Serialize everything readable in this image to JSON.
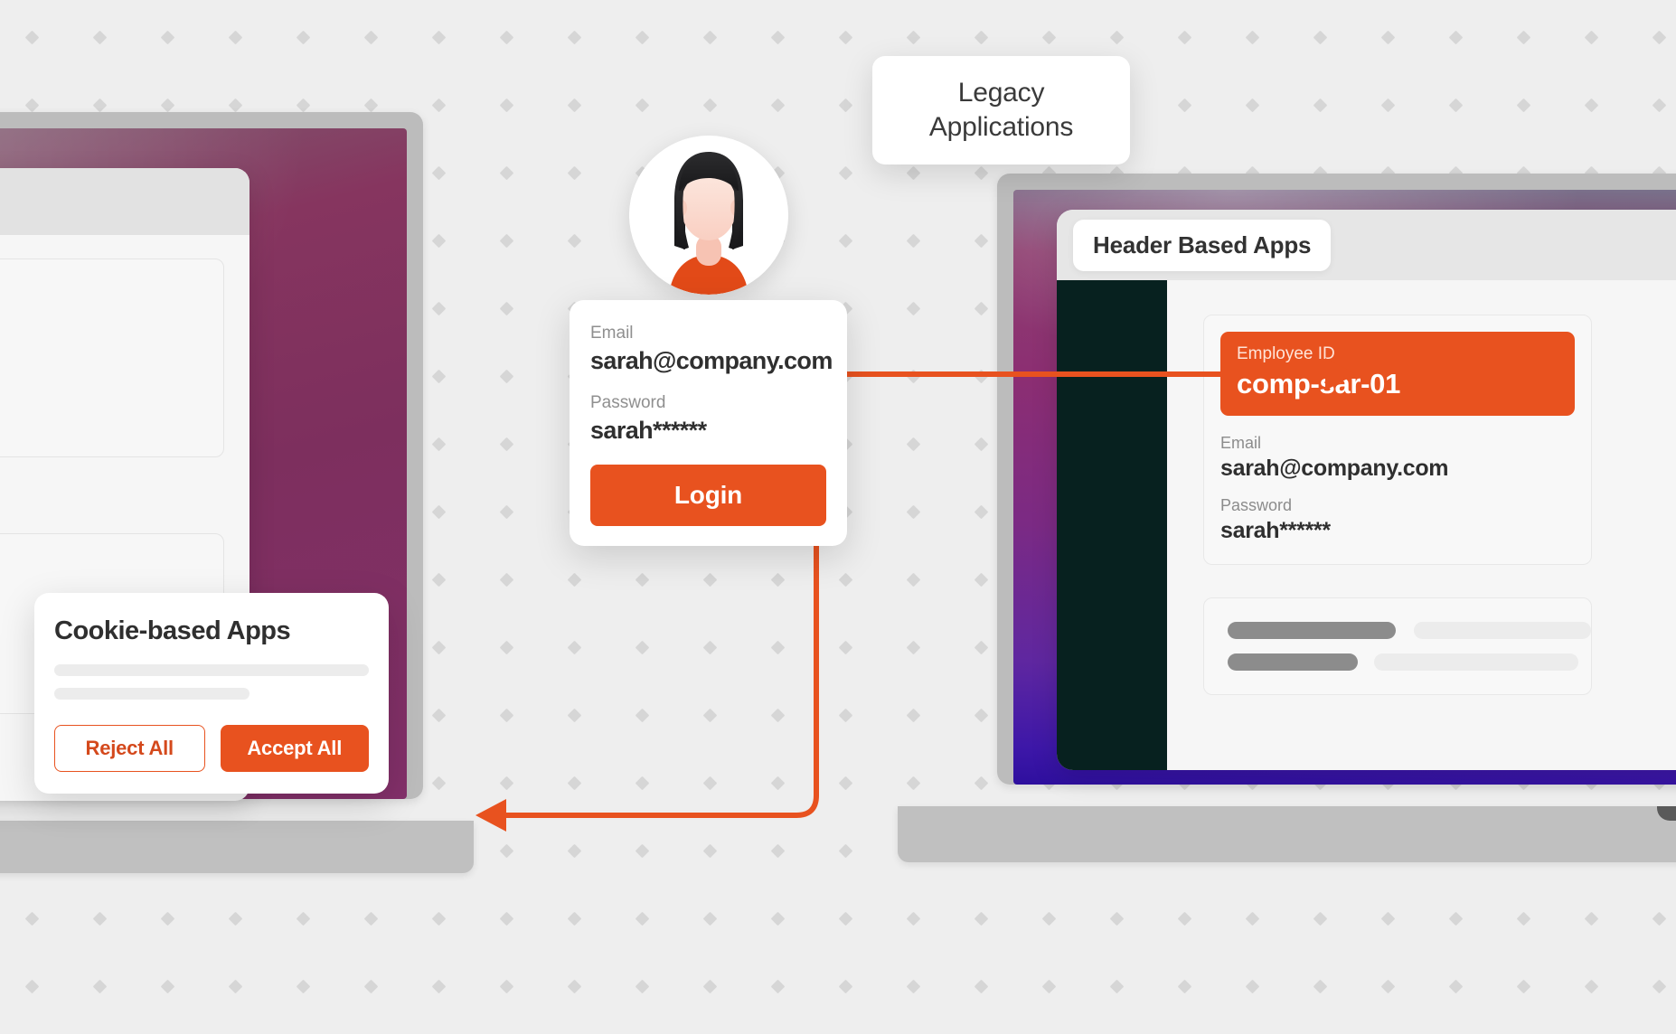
{
  "theme": {
    "accent": "#E8521F",
    "background": "#EEEEEE",
    "dark_text": "#2F2F2F",
    "muted_text": "#8C8C8C",
    "sidebar_dark": "#07211F"
  },
  "legacy_card": {
    "line1": "Legacy",
    "line2": "Applications"
  },
  "avatar": {
    "name": "user-avatar",
    "skin": "#FBDDD2",
    "hair": "#231F20",
    "shirt": "#E8521F"
  },
  "login_card": {
    "email_label": "Email",
    "email_value": "sarah@company.com",
    "password_label": "Password",
    "password_value": "sarah******",
    "submit_label": "Login"
  },
  "cookie_card": {
    "title": "Cookie-based Apps",
    "reject_label": "Reject All",
    "accept_label": "Accept All"
  },
  "header_app": {
    "title": "Header Based Apps",
    "employee_id_label": "Employee ID",
    "employee_id_value": "comp-sar-01",
    "email_label": "Email",
    "email_value": "sarah@company.com",
    "password_label": "Password",
    "password_value": "sarah******"
  }
}
